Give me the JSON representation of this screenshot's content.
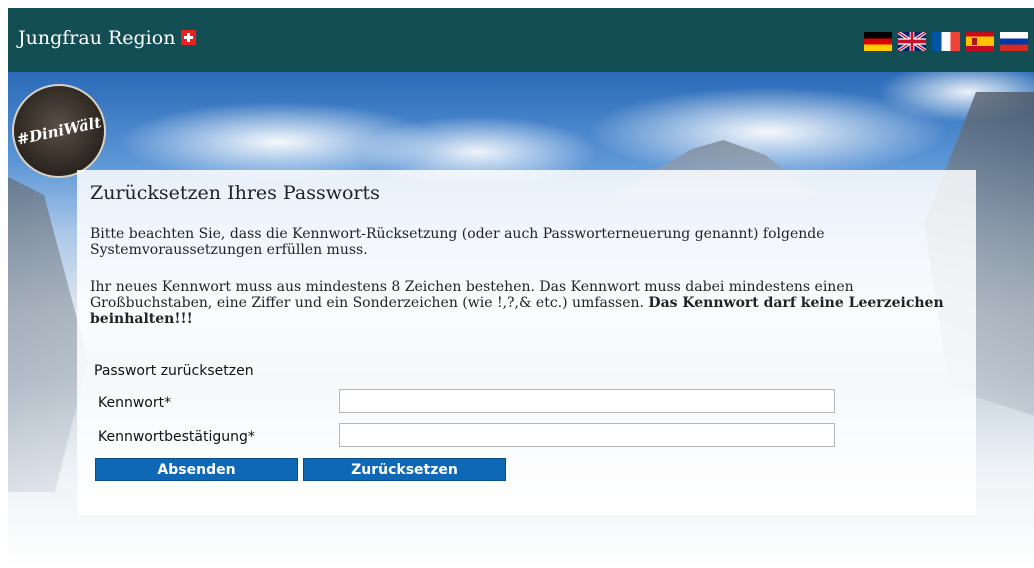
{
  "header": {
    "brand": "Jungfrau Region",
    "brand_bg": "#144e55",
    "flags": [
      {
        "name": "german-flag-icon",
        "lang": "de"
      },
      {
        "name": "uk-flag-icon",
        "lang": "en"
      },
      {
        "name": "french-flag-icon",
        "lang": "fr"
      },
      {
        "name": "spanish-flag-icon",
        "lang": "es"
      },
      {
        "name": "russian-flag-icon",
        "lang": "ru"
      }
    ]
  },
  "logo": {
    "text": "#DiniWält"
  },
  "panel": {
    "title": "Zurücksetzen Ihres Passworts",
    "paragraph1": "Bitte beachten Sie, dass die Kennwort-Rücksetzung (oder auch Passworterneuerung genannt) folgende Systemvoraussetzungen erfüllen muss.",
    "paragraph2": "Ihr neues Kennwort muss aus mindestens 8 Zeichen bestehen. Das Kennwort muss dabei mindestens einen Großbuchstaben, eine Ziffer und ein Sonderzeichen (wie !,?,& etc.) umfassen. ",
    "paragraph2_bold": "Das Kennwort darf keine Leerzeichen beinhalten!!!"
  },
  "form": {
    "heading": "Passwort zurücksetzen",
    "password_label": "Kennwort*",
    "password_value": "",
    "confirm_label": "Kennwortbestätigung*",
    "confirm_value": "",
    "submit_label": "Absenden",
    "reset_label": "Zurücksetzen",
    "button_color": "#0f68b5"
  }
}
